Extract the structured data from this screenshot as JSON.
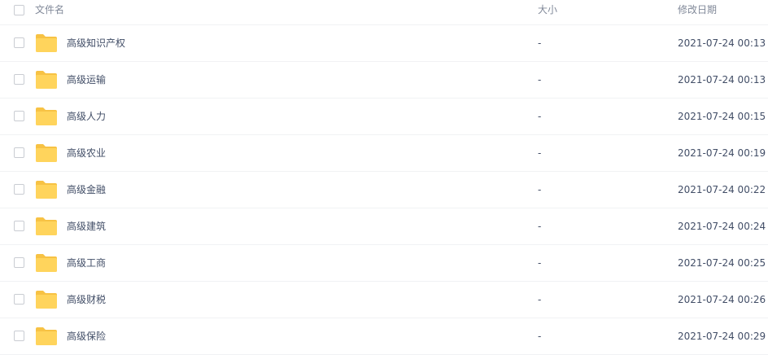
{
  "header": {
    "name_label": "文件名",
    "size_label": "大小",
    "modified_label": "修改日期"
  },
  "folder_color": "#ffd45c",
  "folder_tab_color": "#f7c244",
  "files": [
    {
      "name": "高级知识产权",
      "size": "-",
      "modified": "2021-07-24 00:13",
      "icon": "folder-icon"
    },
    {
      "name": "高级运输",
      "size": "-",
      "modified": "2021-07-24 00:13",
      "icon": "folder-icon"
    },
    {
      "name": "高级人力",
      "size": "-",
      "modified": "2021-07-24 00:15",
      "icon": "folder-icon"
    },
    {
      "name": "高级农业",
      "size": "-",
      "modified": "2021-07-24 00:19",
      "icon": "folder-icon"
    },
    {
      "name": "高级金融",
      "size": "-",
      "modified": "2021-07-24 00:22",
      "icon": "folder-icon"
    },
    {
      "name": "高级建筑",
      "size": "-",
      "modified": "2021-07-24 00:24",
      "icon": "folder-icon"
    },
    {
      "name": "高级工商",
      "size": "-",
      "modified": "2021-07-24 00:25",
      "icon": "folder-icon"
    },
    {
      "name": "高级财税",
      "size": "-",
      "modified": "2021-07-24 00:26",
      "icon": "folder-icon"
    },
    {
      "name": "高级保险",
      "size": "-",
      "modified": "2021-07-24 00:29",
      "icon": "folder-icon"
    }
  ]
}
